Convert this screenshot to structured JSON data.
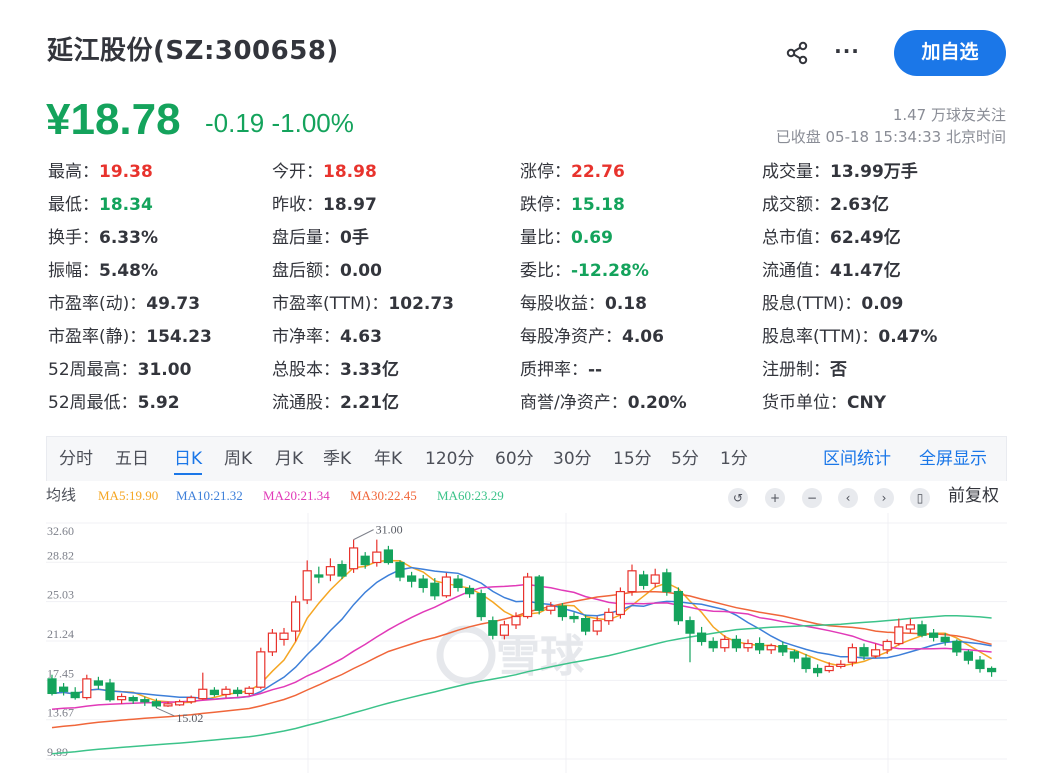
{
  "header": {
    "stock_name": "延江股份(SZ:300658)",
    "follow_label": "加自选",
    "more_label": "···"
  },
  "quote": {
    "price": "¥18.78",
    "change": "-0.19 -1.00%",
    "followers": "1.47 万球友关注",
    "close_time": "已收盘 05-18 15:34:33 北京时间"
  },
  "stats": [
    {
      "label": "最高：",
      "value": "19.38",
      "tone": "up"
    },
    {
      "label": "今开：",
      "value": "18.98",
      "tone": "up"
    },
    {
      "label": "涨停：",
      "value": "22.76",
      "tone": "up"
    },
    {
      "label": "成交量：",
      "value": "13.99万手",
      "tone": ""
    },
    {
      "label": "最低：",
      "value": "18.34",
      "tone": "down"
    },
    {
      "label": "昨收：",
      "value": "18.97",
      "tone": ""
    },
    {
      "label": "跌停：",
      "value": "15.18",
      "tone": "down"
    },
    {
      "label": "成交额：",
      "value": "2.63亿",
      "tone": ""
    },
    {
      "label": "换手：",
      "value": "6.33%",
      "tone": ""
    },
    {
      "label": "盘后量：",
      "value": "0手",
      "tone": ""
    },
    {
      "label": "量比：",
      "value": "0.69",
      "tone": "down"
    },
    {
      "label": "总市值：",
      "value": "62.49亿",
      "tone": ""
    },
    {
      "label": "振幅：",
      "value": "5.48%",
      "tone": ""
    },
    {
      "label": "盘后额：",
      "value": "0.00",
      "tone": ""
    },
    {
      "label": "委比：",
      "value": "-12.28%",
      "tone": "down"
    },
    {
      "label": "流通值：",
      "value": "41.47亿",
      "tone": ""
    },
    {
      "label": "市盈率(动)：",
      "value": "49.73",
      "tone": ""
    },
    {
      "label": "市盈率(TTM)：",
      "value": "102.73",
      "tone": ""
    },
    {
      "label": "每股收益：",
      "value": "0.18",
      "tone": ""
    },
    {
      "label": "股息(TTM)：",
      "value": "0.09",
      "tone": ""
    },
    {
      "label": "市盈率(静)：",
      "value": "154.23",
      "tone": ""
    },
    {
      "label": "市净率：",
      "value": "4.63",
      "tone": ""
    },
    {
      "label": "每股净资产：",
      "value": "4.06",
      "tone": ""
    },
    {
      "label": "股息率(TTM)：",
      "value": "0.47%",
      "tone": ""
    },
    {
      "label": "52周最高：",
      "value": "31.00",
      "tone": ""
    },
    {
      "label": "总股本：",
      "value": "3.33亿",
      "tone": ""
    },
    {
      "label": "质押率：",
      "value": "--",
      "tone": ""
    },
    {
      "label": "注册制：",
      "value": "否",
      "tone": ""
    },
    {
      "label": "52周最低：",
      "value": "5.92",
      "tone": ""
    },
    {
      "label": "流通股：",
      "value": "2.21亿",
      "tone": ""
    },
    {
      "label": "商誉/净资产：",
      "value": "0.20%",
      "tone": ""
    },
    {
      "label": "货币单位：",
      "value": "CNY",
      "tone": ""
    }
  ],
  "tabs": [
    "分时",
    "五日",
    "日K",
    "周K",
    "月K",
    "季K",
    "年K",
    "120分",
    "60分",
    "30分",
    "15分",
    "5分",
    "1分"
  ],
  "active_tab": "日K",
  "tab_actions": {
    "stats": "区间统计",
    "fullscreen": "全屏显示"
  },
  "ma": {
    "label": "均线",
    "items": [
      {
        "text": "MA5:19.90",
        "color": "#f5a623"
      },
      {
        "text": "MA10:21.32",
        "color": "#3d7fd9"
      },
      {
        "text": "MA20:21.34",
        "color": "#e13ab8"
      },
      {
        "text": "MA30:22.45",
        "color": "#f0663a"
      },
      {
        "text": "MA60:23.29",
        "color": "#3cc38a"
      }
    ]
  },
  "chart_controls": {
    "fq_label": "前复权"
  },
  "watermark": "雪球",
  "colors": {
    "up": "#e8332d",
    "down": "#14a35c",
    "accent": "#1b77e8"
  },
  "chart_data": {
    "type": "candlestick",
    "y_ticks": [
      "32.60",
      "28.82",
      "25.03",
      "21.24",
      "17.45",
      "13.67",
      "9.89"
    ],
    "ylim": [
      9.89,
      32.6
    ],
    "annotations": [
      {
        "text": "31.00",
        "kind": "high"
      },
      {
        "text": "15.02",
        "kind": "low"
      }
    ],
    "candles": [
      {
        "o": 17.6,
        "c": 16.2,
        "h": 18.0,
        "l": 16.0
      },
      {
        "o": 16.8,
        "c": 16.4,
        "h": 17.2,
        "l": 16.0
      },
      {
        "o": 16.3,
        "c": 15.8,
        "h": 16.8,
        "l": 15.6
      },
      {
        "o": 15.8,
        "c": 17.6,
        "h": 18.0,
        "l": 15.6
      },
      {
        "o": 17.4,
        "c": 17.0,
        "h": 17.8,
        "l": 16.6
      },
      {
        "o": 17.2,
        "c": 15.6,
        "h": 17.6,
        "l": 15.4
      },
      {
        "o": 15.6,
        "c": 15.9,
        "h": 16.2,
        "l": 15.2
      },
      {
        "o": 15.8,
        "c": 15.5,
        "h": 16.0,
        "l": 15.2
      },
      {
        "o": 15.6,
        "c": 15.4,
        "h": 15.9,
        "l": 15.0
      },
      {
        "o": 15.4,
        "c": 15.0,
        "h": 15.7,
        "l": 14.8
      },
      {
        "o": 15.0,
        "c": 15.2,
        "h": 15.4,
        "l": 14.9
      },
      {
        "o": 15.1,
        "c": 15.4,
        "h": 15.6,
        "l": 15.0
      },
      {
        "o": 15.4,
        "c": 15.8,
        "h": 16.0,
        "l": 15.2
      },
      {
        "o": 15.7,
        "c": 16.6,
        "h": 18.2,
        "l": 15.6
      },
      {
        "o": 16.5,
        "c": 16.1,
        "h": 16.8,
        "l": 15.9
      },
      {
        "o": 16.1,
        "c": 16.6,
        "h": 16.9,
        "l": 15.8
      },
      {
        "o": 16.5,
        "c": 16.2,
        "h": 16.8,
        "l": 15.9
      },
      {
        "o": 16.2,
        "c": 16.7,
        "h": 16.9,
        "l": 16.0
      },
      {
        "o": 16.8,
        "c": 20.2,
        "h": 20.6,
        "l": 16.6
      },
      {
        "o": 20.2,
        "c": 22.0,
        "h": 22.4,
        "l": 19.8
      },
      {
        "o": 21.4,
        "c": 22.0,
        "h": 22.5,
        "l": 20.8
      },
      {
        "o": 22.2,
        "c": 25.0,
        "h": 25.6,
        "l": 21.2
      },
      {
        "o": 25.2,
        "c": 28.0,
        "h": 29.0,
        "l": 24.8
      },
      {
        "o": 27.6,
        "c": 27.4,
        "h": 28.4,
        "l": 26.8
      },
      {
        "o": 27.6,
        "c": 28.4,
        "h": 29.2,
        "l": 27.0
      },
      {
        "o": 28.6,
        "c": 27.5,
        "h": 29.0,
        "l": 27.2
      },
      {
        "o": 28.2,
        "c": 30.2,
        "h": 31.0,
        "l": 27.8
      },
      {
        "o": 29.4,
        "c": 28.6,
        "h": 29.8,
        "l": 28.2
      },
      {
        "o": 28.8,
        "c": 29.8,
        "h": 31.0,
        "l": 28.4
      },
      {
        "o": 30.0,
        "c": 28.8,
        "h": 30.4,
        "l": 28.6
      },
      {
        "o": 28.8,
        "c": 27.4,
        "h": 29.0,
        "l": 27.0
      },
      {
        "o": 27.5,
        "c": 27.0,
        "h": 27.9,
        "l": 26.4
      },
      {
        "o": 27.2,
        "c": 26.4,
        "h": 27.6,
        "l": 25.9
      },
      {
        "o": 26.8,
        "c": 25.6,
        "h": 27.3,
        "l": 25.2
      },
      {
        "o": 25.6,
        "c": 27.4,
        "h": 27.8,
        "l": 25.4
      },
      {
        "o": 27.2,
        "c": 26.4,
        "h": 27.6,
        "l": 26.0
      },
      {
        "o": 26.3,
        "c": 25.8,
        "h": 26.6,
        "l": 25.4
      },
      {
        "o": 25.8,
        "c": 23.6,
        "h": 26.2,
        "l": 23.2
      },
      {
        "o": 23.2,
        "c": 21.8,
        "h": 23.6,
        "l": 21.4
      },
      {
        "o": 21.8,
        "c": 22.8,
        "h": 23.2,
        "l": 21.4
      },
      {
        "o": 22.8,
        "c": 23.6,
        "h": 24.0,
        "l": 22.4
      },
      {
        "o": 23.6,
        "c": 27.4,
        "h": 27.8,
        "l": 23.4
      },
      {
        "o": 27.4,
        "c": 24.2,
        "h": 27.6,
        "l": 23.8
      },
      {
        "o": 24.2,
        "c": 24.6,
        "h": 25.0,
        "l": 23.8
      },
      {
        "o": 24.6,
        "c": 23.6,
        "h": 24.9,
        "l": 23.2
      },
      {
        "o": 23.6,
        "c": 23.4,
        "h": 24.0,
        "l": 23.0
      },
      {
        "o": 23.4,
        "c": 22.2,
        "h": 23.8,
        "l": 21.8
      },
      {
        "o": 22.2,
        "c": 23.2,
        "h": 23.6,
        "l": 21.8
      },
      {
        "o": 23.2,
        "c": 24.0,
        "h": 24.4,
        "l": 22.8
      },
      {
        "o": 23.8,
        "c": 26.0,
        "h": 26.4,
        "l": 23.4
      },
      {
        "o": 26.0,
        "c": 28.0,
        "h": 28.6,
        "l": 25.6
      },
      {
        "o": 27.6,
        "c": 26.6,
        "h": 28.0,
        "l": 26.2
      },
      {
        "o": 26.8,
        "c": 27.6,
        "h": 28.2,
        "l": 26.4
      },
      {
        "o": 27.8,
        "c": 26.0,
        "h": 28.2,
        "l": 25.6
      },
      {
        "o": 26.0,
        "c": 23.2,
        "h": 26.4,
        "l": 22.8
      },
      {
        "o": 23.2,
        "c": 22.0,
        "h": 23.6,
        "l": 19.2
      },
      {
        "o": 22.0,
        "c": 21.2,
        "h": 22.6,
        "l": 20.8
      },
      {
        "o": 21.2,
        "c": 20.6,
        "h": 21.6,
        "l": 20.2
      },
      {
        "o": 20.6,
        "c": 21.4,
        "h": 21.8,
        "l": 20.2
      },
      {
        "o": 21.4,
        "c": 20.6,
        "h": 21.8,
        "l": 20.2
      },
      {
        "o": 20.6,
        "c": 21.0,
        "h": 21.4,
        "l": 20.2
      },
      {
        "o": 21.0,
        "c": 20.4,
        "h": 21.6,
        "l": 20.0
      },
      {
        "o": 20.4,
        "c": 20.8,
        "h": 21.0,
        "l": 20.0
      },
      {
        "o": 20.8,
        "c": 20.2,
        "h": 21.2,
        "l": 19.8
      },
      {
        "o": 20.2,
        "c": 19.6,
        "h": 20.4,
        "l": 19.2
      },
      {
        "o": 19.6,
        "c": 18.6,
        "h": 20.0,
        "l": 18.2
      },
      {
        "o": 18.6,
        "c": 18.2,
        "h": 19.0,
        "l": 17.8
      },
      {
        "o": 18.4,
        "c": 18.8,
        "h": 19.2,
        "l": 18.2
      },
      {
        "o": 18.8,
        "c": 19.0,
        "h": 19.4,
        "l": 18.6
      },
      {
        "o": 19.2,
        "c": 20.6,
        "h": 21.0,
        "l": 18.8
      },
      {
        "o": 20.6,
        "c": 19.8,
        "h": 21.0,
        "l": 19.4
      },
      {
        "o": 19.8,
        "c": 20.4,
        "h": 21.0,
        "l": 19.6
      },
      {
        "o": 20.4,
        "c": 21.2,
        "h": 21.4,
        "l": 20.0
      },
      {
        "o": 21.0,
        "c": 22.6,
        "h": 23.4,
        "l": 20.8
      },
      {
        "o": 22.4,
        "c": 22.8,
        "h": 23.4,
        "l": 22.0
      },
      {
        "o": 22.8,
        "c": 21.8,
        "h": 23.2,
        "l": 21.6
      },
      {
        "o": 22.0,
        "c": 21.6,
        "h": 22.4,
        "l": 21.2
      },
      {
        "o": 21.6,
        "c": 21.2,
        "h": 22.0,
        "l": 20.8
      },
      {
        "o": 21.2,
        "c": 20.2,
        "h": 21.4,
        "l": 19.8
      },
      {
        "o": 20.2,
        "c": 19.4,
        "h": 20.4,
        "l": 19.0
      },
      {
        "o": 19.4,
        "c": 18.6,
        "h": 19.8,
        "l": 18.2
      },
      {
        "o": 18.6,
        "c": 18.3,
        "h": 18.8,
        "l": 17.8
      }
    ]
  }
}
